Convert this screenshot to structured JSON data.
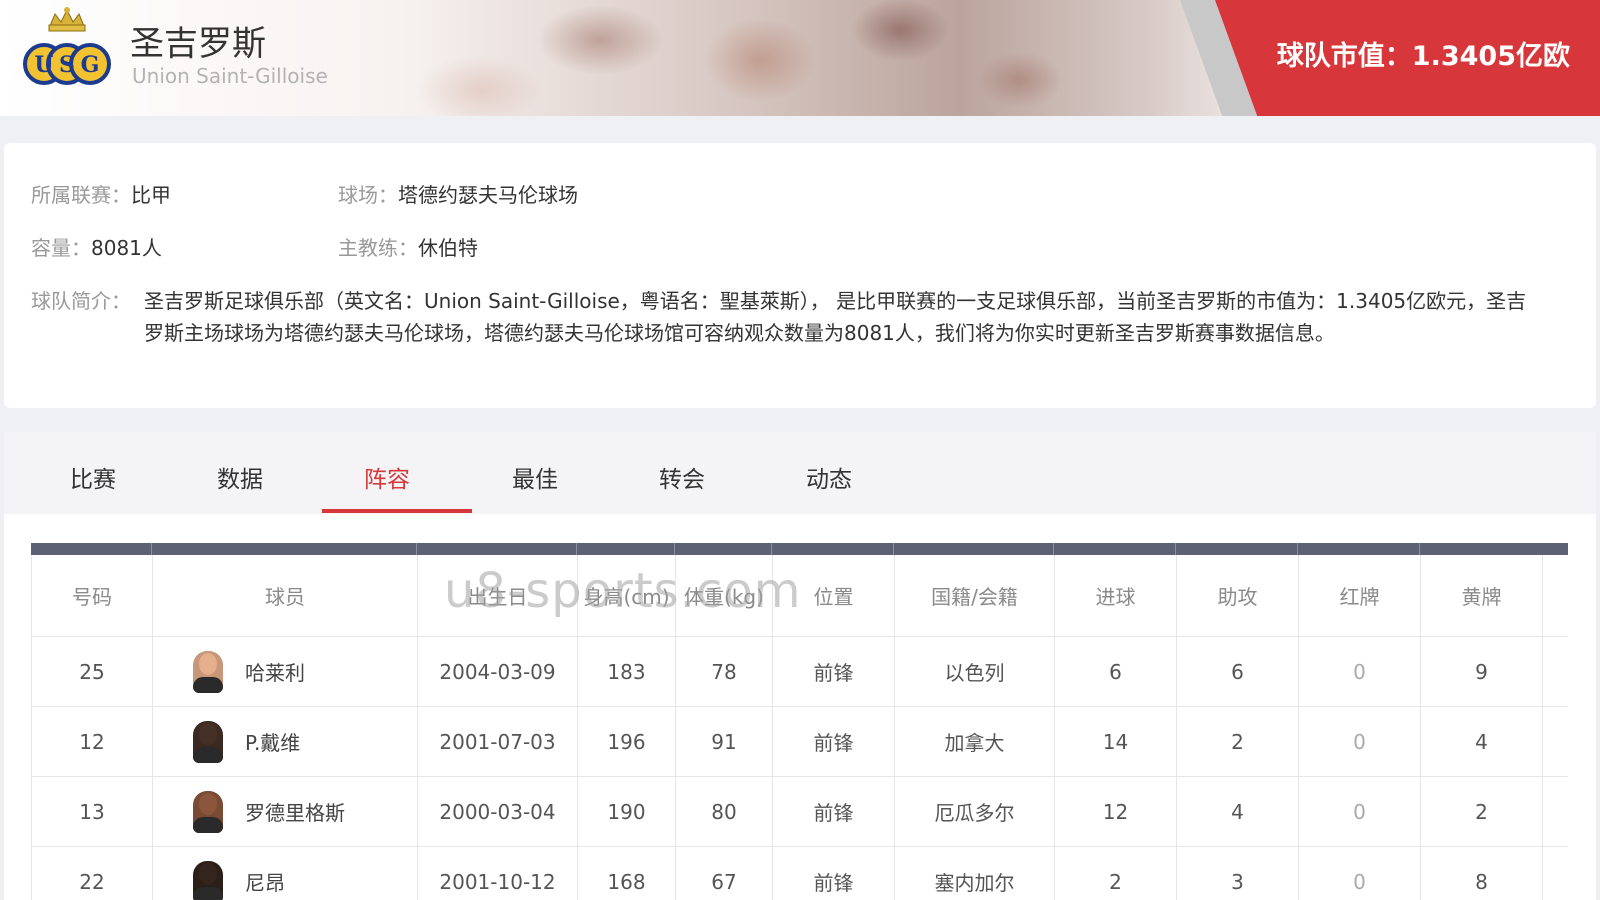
{
  "header": {
    "team_name_cn": "圣吉罗斯",
    "team_name_en": "Union Saint-Gilloise",
    "market_value": "球队市值：1.3405亿欧",
    "logo_letters": "USG",
    "brand_color": "#d7363a"
  },
  "info": {
    "league_label": "所属联赛：",
    "league_value": "比甲",
    "stadium_label": "球场：",
    "stadium_value": "塔德约瑟夫马伦球场",
    "capacity_label": "容量：",
    "capacity_value": "8081人",
    "coach_label": "主教练：",
    "coach_value": "休伯特",
    "intro_label": "球队简介：",
    "intro_text": "圣吉罗斯足球俱乐部（英文名：Union Saint-Gilloise，粤语名：聖基萊斯）， 是比甲联赛的一支足球俱乐部，当前圣吉罗斯的市值为：1.3405亿欧元，圣吉罗斯主场球场为塔德约瑟夫马伦球场，塔德约瑟夫马伦球场馆可容纳观众数量为8081人，我们将为你实时更新圣吉罗斯赛事数据信息。"
  },
  "tabs": [
    {
      "label": "比赛"
    },
    {
      "label": "数据"
    },
    {
      "label": "阵容"
    },
    {
      "label": "最佳"
    },
    {
      "label": "转会"
    },
    {
      "label": "动态"
    }
  ],
  "active_tab": "阵容",
  "roster": {
    "headers": [
      "号码",
      "球员",
      "出生日",
      "身高(cm)",
      "体重(kg)",
      "位置",
      "国籍/会籍",
      "进球",
      "助攻",
      "红牌",
      "黄牌"
    ],
    "rows": [
      {
        "number": "25",
        "name": "哈莱利",
        "birth": "2004-03-09",
        "height": "183",
        "weight": "78",
        "position": "前锋",
        "nationality": "以色列",
        "goals": "6",
        "assists": "6",
        "red": "0",
        "yellow": "9"
      },
      {
        "number": "12",
        "name": "P.戴维",
        "birth": "2001-07-03",
        "height": "196",
        "weight": "91",
        "position": "前锋",
        "nationality": "加拿大",
        "goals": "14",
        "assists": "2",
        "red": "0",
        "yellow": "4"
      },
      {
        "number": "13",
        "name": "罗德里格斯",
        "birth": "2000-03-04",
        "height": "190",
        "weight": "80",
        "position": "前锋",
        "nationality": "厄瓜多尔",
        "goals": "12",
        "assists": "4",
        "red": "0",
        "yellow": "2"
      },
      {
        "number": "22",
        "name": "尼昂",
        "birth": "2001-10-12",
        "height": "168",
        "weight": "67",
        "position": "前锋",
        "nationality": "塞内加尔",
        "goals": "2",
        "assists": "3",
        "red": "0",
        "yellow": "8"
      }
    ]
  },
  "watermark": "u8-sports.com"
}
